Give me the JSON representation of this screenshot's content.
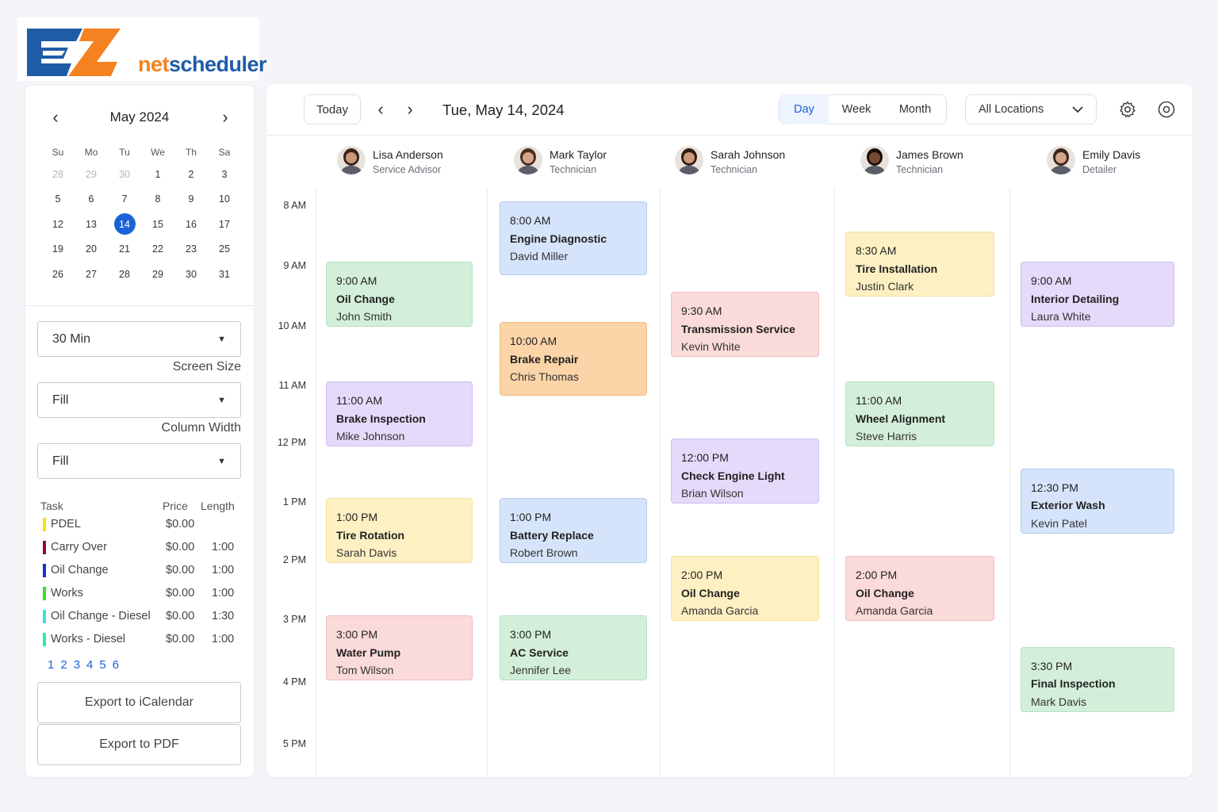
{
  "brand": {
    "net": "net",
    "scheduler": "scheduler"
  },
  "mini_calendar": {
    "month_title": "May 2024",
    "days_of_week": [
      "Su",
      "Mo",
      "Tu",
      "We",
      "Th",
      "Sa"
    ],
    "weeks": [
      [
        {
          "d": "28",
          "muted": true
        },
        {
          "d": "29",
          "muted": true
        },
        {
          "d": "30",
          "muted": true
        },
        {
          "d": "1"
        },
        {
          "d": "2"
        },
        {
          "d": "3"
        }
      ],
      [
        {
          "d": "5"
        },
        {
          "d": "6"
        },
        {
          "d": "7"
        },
        {
          "d": "8"
        },
        {
          "d": "9"
        },
        {
          "d": "10"
        }
      ],
      [
        {
          "d": "12"
        },
        {
          "d": "13"
        },
        {
          "d": "14",
          "selected": true
        },
        {
          "d": "15"
        },
        {
          "d": "16"
        },
        {
          "d": "17"
        }
      ],
      [
        {
          "d": "19"
        },
        {
          "d": "20"
        },
        {
          "d": "21"
        },
        {
          "d": "22"
        },
        {
          "d": "23"
        },
        {
          "d": "25"
        }
      ],
      [
        {
          "d": "26"
        },
        {
          "d": "27"
        },
        {
          "d": "28"
        },
        {
          "d": "29"
        },
        {
          "d": "30"
        },
        {
          "d": "31"
        }
      ]
    ]
  },
  "settings": {
    "interval": "30 Min",
    "screen_size_label": "Screen Size",
    "screen_size_value": "Fill",
    "column_width_label": "Column Width",
    "column_width_value": "Fill"
  },
  "tasks": {
    "headers": {
      "task": "Task",
      "price": "Price",
      "length": "Length"
    },
    "rows": [
      {
        "name": "PDEL",
        "price": "$0.00",
        "length": "",
        "color": "#f5e400"
      },
      {
        "name": "Carry Over",
        "price": "$0.00",
        "length": "1:00",
        "color": "#8b1030"
      },
      {
        "name": "Oil Change",
        "price": "$0.00",
        "length": "1:00",
        "color": "#1a2fd6"
      },
      {
        "name": "Works",
        "price": "$0.00",
        "length": "1:00",
        "color": "#3ddc2a"
      },
      {
        "name": "Oil Change - Diesel",
        "price": "$0.00",
        "length": "1:30",
        "color": "#3fe0e0"
      },
      {
        "name": "Works - Diesel",
        "price": "$0.00",
        "length": "1:00",
        "color": "#2ee8b8"
      }
    ],
    "pages": [
      "1",
      "2",
      "3",
      "4",
      "5",
      "6"
    ]
  },
  "export": {
    "ical": "Export to iCalendar",
    "pdf": "Export to PDF"
  },
  "toolbar": {
    "today": "Today",
    "date_title": "Tue, May 14, 2024",
    "views": [
      "Day",
      "Week",
      "Month"
    ],
    "active_view": "Day",
    "location": "All Locations"
  },
  "staff": [
    {
      "name": "Lisa Anderson",
      "role": "Service Advisor",
      "skin": "#c99878",
      "hair": "#3a2418"
    },
    {
      "name": "Mark Taylor",
      "role": "Technician",
      "skin": "#d6a587",
      "hair": "#4a3020"
    },
    {
      "name": "Sarah Johnson",
      "role": "Technician",
      "skin": "#cf9a7c",
      "hair": "#2e1c14"
    },
    {
      "name": "James Brown",
      "role": "Technician",
      "skin": "#7a4a30",
      "hair": "#1a100a"
    },
    {
      "name": "Emily Davis",
      "role": "Detailer",
      "skin": "#d4a48a",
      "hair": "#3a2418"
    }
  ],
  "times": [
    "8 AM",
    "9 AM",
    "10 AM",
    "11 AM",
    "12 PM",
    "1 PM",
    "2 PM",
    "3 PM",
    "4 PM",
    "5 PM"
  ],
  "appointments": [
    {
      "col": 0,
      "time": "9:00 AM",
      "service": "Oil Change",
      "customer": "John Smith",
      "color": "green"
    },
    {
      "col": 0,
      "time": "11:00 AM",
      "service": "Brake Inspection",
      "customer": "Mike Johnson",
      "color": "purple"
    },
    {
      "col": 0,
      "time": "1:00 PM",
      "service": "Tire Rotation",
      "customer": "Sarah Davis",
      "color": "yellow"
    },
    {
      "col": 0,
      "time": "3:00 PM",
      "service": "Water Pump",
      "customer": "Tom Wilson",
      "color": "red"
    },
    {
      "col": 1,
      "time": "8:00 AM",
      "service": "Engine Diagnostic",
      "customer": "David Miller",
      "color": "blue"
    },
    {
      "col": 1,
      "time": "10:00 AM",
      "service": "Brake Repair",
      "customer": "Chris Thomas",
      "color": "orange"
    },
    {
      "col": 1,
      "time": "1:00 PM",
      "service": "Battery Replace",
      "customer": "Robert Brown",
      "color": "blue"
    },
    {
      "col": 1,
      "time": "3:00 PM",
      "service": "AC Service",
      "customer": "Jennifer Lee",
      "color": "green"
    },
    {
      "col": 2,
      "time": "9:30 AM",
      "service": "Transmission Service",
      "customer": "Kevin White",
      "color": "red"
    },
    {
      "col": 2,
      "time": "12:00 PM",
      "service": "Check Engine Light",
      "customer": "Brian Wilson",
      "color": "purple"
    },
    {
      "col": 2,
      "time": "2:00 PM",
      "service": "Oil Change",
      "customer": "Amanda Garcia",
      "color": "yellow"
    },
    {
      "col": 3,
      "time": "8:30 AM",
      "service": "Tire Installation",
      "customer": "Justin Clark",
      "color": "yellow"
    },
    {
      "col": 3,
      "time": "11:00 AM",
      "service": "Wheel Alignment",
      "customer": "Steve Harris",
      "color": "green"
    },
    {
      "col": 3,
      "time": "2:00 PM",
      "service": "Oil Change",
      "customer": "Amanda Garcia",
      "color": "red"
    },
    {
      "col": 4,
      "time": "9:00 AM",
      "service": "Interior Detailing",
      "customer": "Laura White",
      "color": "purple"
    },
    {
      "col": 4,
      "time": "12:30 PM",
      "service": "Exterior Wash",
      "customer": "Kevin Patel",
      "color": "blue"
    },
    {
      "col": 4,
      "time": "3:30 PM",
      "service": "Final Inspection",
      "customer": "Mark Davis",
      "color": "green"
    }
  ]
}
